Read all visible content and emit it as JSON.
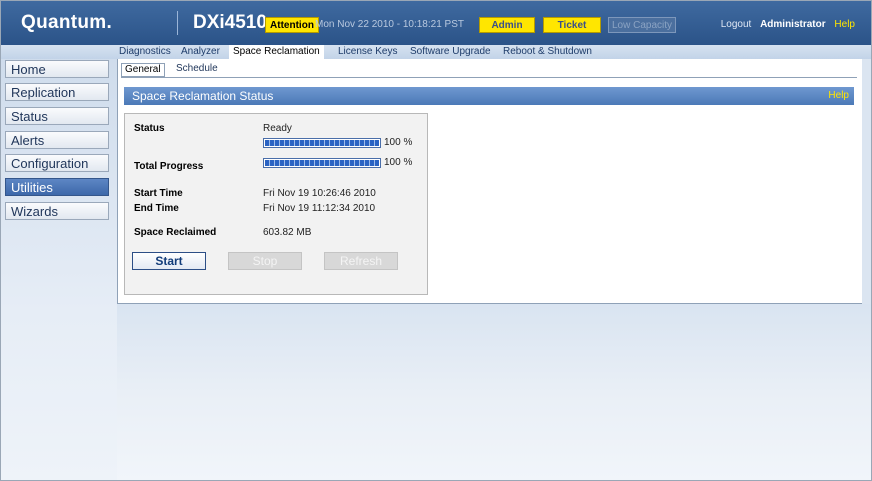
{
  "header": {
    "logo": "Quantum.",
    "product": "DXi4510",
    "attention": "Attention",
    "datetime": "Mon Nov 22 2010 - 10:18:21 PST",
    "admin": "Admin",
    "ticket": "Ticket",
    "low_capacity": "Low Capacity",
    "logout": "Logout",
    "user": "Administrator",
    "help": "Help"
  },
  "topnav": [
    "Diagnostics",
    "Analyzer",
    "Space Reclamation",
    "License Keys",
    "Software Upgrade",
    "Reboot & Shutdown"
  ],
  "topnav_active": "Space Reclamation",
  "sidebar": [
    "Home",
    "Replication",
    "Status",
    "Alerts",
    "Configuration",
    "Utilities",
    "Wizards"
  ],
  "sidebar_active": "Utilities",
  "subtabs": [
    "General",
    "Schedule"
  ],
  "subtab_active": "General",
  "panel": {
    "title": "Space Reclamation Status",
    "help": "Help",
    "status_label": "Status",
    "status_value": "Ready",
    "stage_progress_value": 100,
    "stage_progress_text": "100 %",
    "total_progress_label": "Total Progress",
    "total_progress_value": 100,
    "total_progress_text": "100 %",
    "start_time_label": "Start Time",
    "start_time_value": "Fri Nov 19 10:26:46 2010",
    "end_time_label": "End Time",
    "end_time_value": "Fri Nov 19 11:12:34 2010",
    "space_reclaimed_label": "Space Reclaimed",
    "space_reclaimed_value": "603.82 MB",
    "start_button": "Start",
    "stop_button": "Stop",
    "refresh_button": "Refresh"
  },
  "colors": {
    "header_blue": "#2f5a92",
    "panel_title_blue": "#5a86c3",
    "badge_yellow": "#ffe600",
    "sidebar_active": "#4a75b6"
  }
}
